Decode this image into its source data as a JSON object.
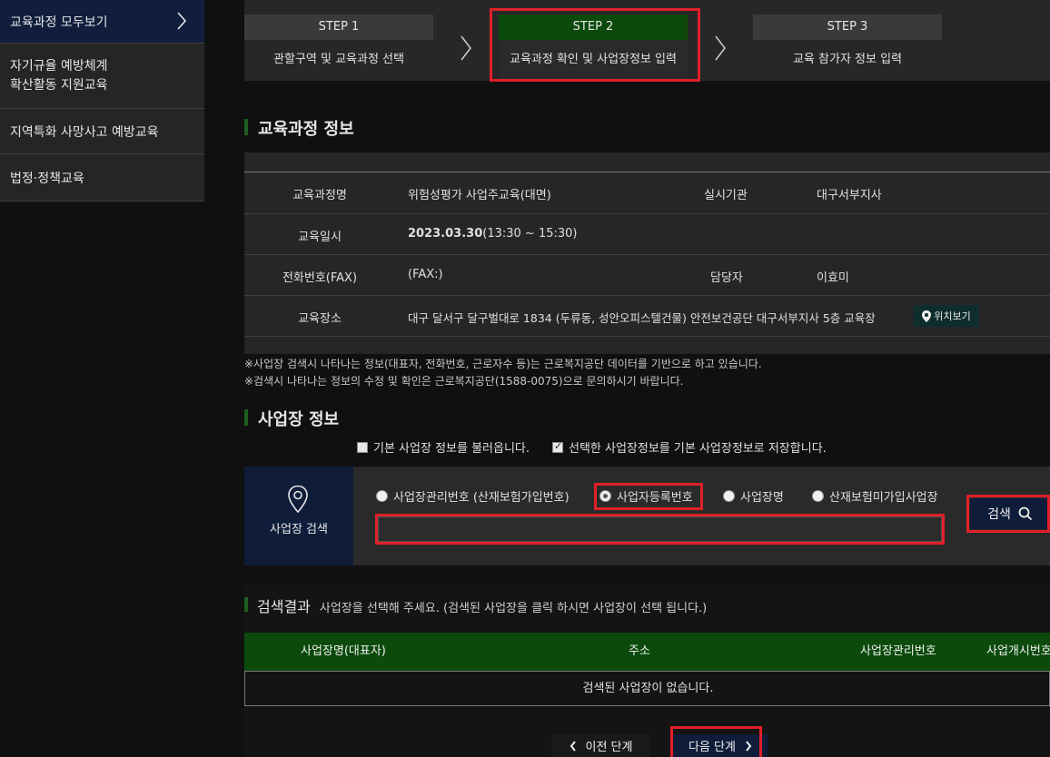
{
  "sidebar": {
    "items": [
      {
        "label": "교육과정 모두보기"
      },
      {
        "label": "자기규율 예방체계"
      },
      {
        "label": "확산활동 지원교육"
      },
      {
        "label": "지역특화 사망사고 예방교육"
      },
      {
        "label": "법정·정책교육"
      }
    ]
  },
  "steps": [
    {
      "head": "STEP 1",
      "desc": "관할구역 및 교육과정 선택"
    },
    {
      "head": "STEP 2",
      "desc": "교육과정 확인 및 사업장정보 입력"
    },
    {
      "head": "STEP 3",
      "desc": "교육 참가자 정보 입력"
    }
  ],
  "course_section": {
    "title": "교육과정 정보",
    "rows": {
      "name_label": "교육과정명",
      "name_value": "위험성평가 사업주교육(대면)",
      "org_label": "실시기관",
      "org_value": "대구서부지사",
      "date_label": "교육일시",
      "date_bold": "2023.03.30",
      "date_time": "(13:30 ~ 15:30)",
      "phone_label": "전화번호(FAX)",
      "phone_value": "(FAX:)",
      "manager_label": "담당자",
      "manager_value": "이효미",
      "place_label": "교육장소",
      "place_value": "대구 달서구 달구벌대로 1834 (두류동, 성안오피스텔건물) 안전보건공단 대구서부지사 5층 교육장",
      "map_button": "위치보기"
    }
  },
  "notes": [
    "※사업장 검색시 나타나는 정보(대표자, 전화번호, 근로자수 등)는 근로복지공단 데이터를 기반으로 하고 있습니다.",
    "※검색시 나타나는 정보의 수정 및 확인은 근로복지공단(1588-0075)으로 문의하시기 바랍니다."
  ],
  "workplace_section": {
    "title": "사업장 정보",
    "load_default": "기본 사업장 정보를 불러옵니다.",
    "save_default": "선택한 사업장정보를 기본 사업장정보로 저장합니다."
  },
  "search": {
    "panel_label": "사업장 검색",
    "options": [
      {
        "label": "사업장관리번호 (산재보험가입번호)",
        "selected": false
      },
      {
        "label": "사업자등록번호",
        "selected": true
      },
      {
        "label": "사업장명",
        "selected": false
      },
      {
        "label": "산재보험미가입사업장",
        "selected": false
      }
    ],
    "input_value": "",
    "button_label": "검색"
  },
  "results": {
    "title": "검색결과",
    "hint": "사업장을 선택해 주세요. (검색된 사업장을 클릭 하시면 사업장이 선택 됩니다.)",
    "columns": [
      "사업장명(대표자)",
      "주소",
      "사업장관리번호",
      "사업개시번호"
    ],
    "empty_text": "검색된 사업장이 없습니다."
  },
  "nav": {
    "prev_label": "이전 단계",
    "next_label": "다음 단계"
  },
  "colors": {
    "accent_green": "#0b4a0b",
    "navy": "#0f1c3a",
    "highlight_red": "#e0202a"
  }
}
